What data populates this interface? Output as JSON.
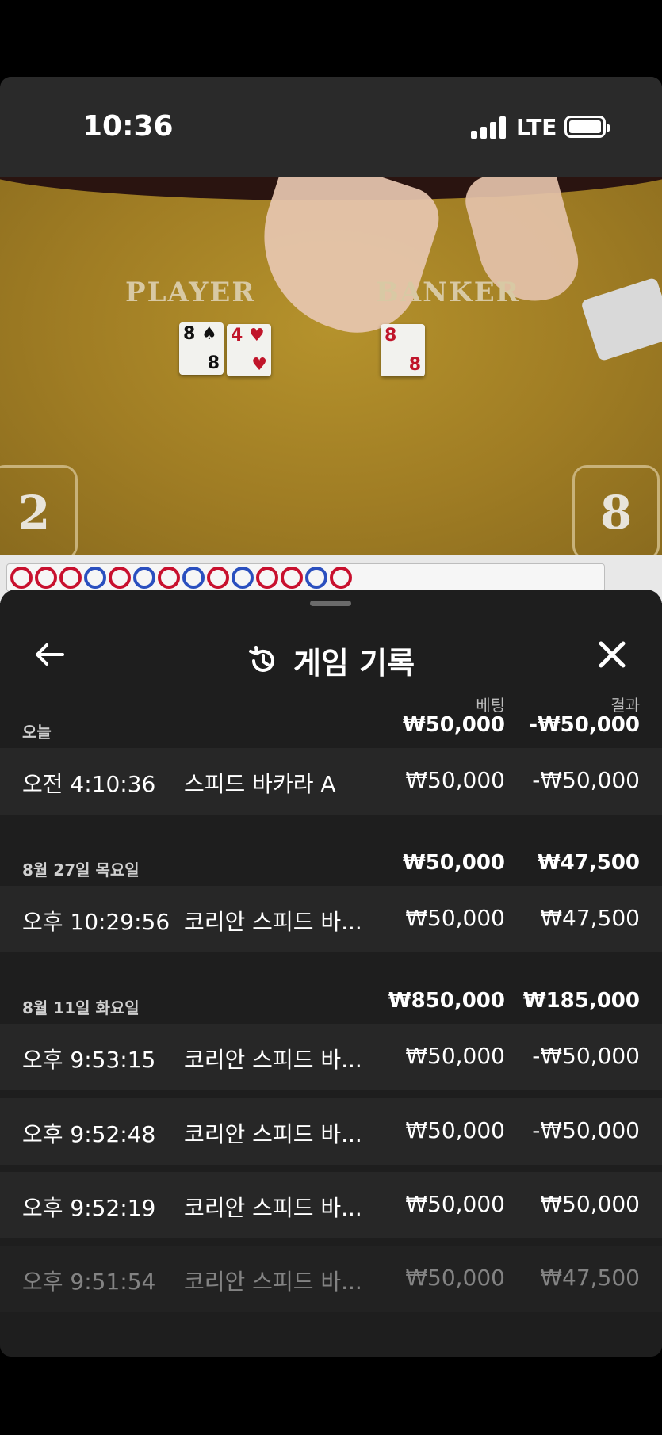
{
  "status_bar": {
    "time": "10:36",
    "network": "LTE"
  },
  "video": {
    "player_label": "PLAYER",
    "banker_label": "BANKER",
    "player_cards": [
      {
        "rank": "8",
        "suit": "♠"
      },
      {
        "rank": "4",
        "suit": "♥"
      }
    ],
    "banker_cards": [
      {
        "rank": "8",
        "suit": "♥"
      }
    ],
    "player_score": "2",
    "banker_score": "8"
  },
  "roadmap": {
    "results": [
      "P",
      "P",
      "P",
      "B",
      "P",
      "B",
      "P",
      "B",
      "P",
      "B",
      "P",
      "P",
      "B",
      "P"
    ]
  },
  "sheet": {
    "title": "게임 기록",
    "col_bet": "베팅",
    "col_result": "결과",
    "groups": [
      {
        "date": "오늘",
        "bet_total": "₩50,000",
        "result_total": "-₩50,000",
        "rows": [
          {
            "time": "오전 4:10:36",
            "game": "스피드 바카라 A",
            "bet": "₩50,000",
            "result": "-₩50,000"
          }
        ]
      },
      {
        "date": "8월 27일 목요일",
        "bet_total": "₩50,000",
        "result_total": "₩47,500",
        "rows": [
          {
            "time": "오후 10:29:56",
            "game": "코리안 스피드 바...",
            "bet": "₩50,000",
            "result": "₩47,500"
          }
        ]
      },
      {
        "date": "8월 11일 화요일",
        "bet_total": "₩850,000",
        "result_total": "₩185,000",
        "rows": [
          {
            "time": "오후 9:53:15",
            "game": "코리안 스피드 바...",
            "bet": "₩50,000",
            "result": "-₩50,000"
          },
          {
            "time": "오후 9:52:48",
            "game": "코리안 스피드 바...",
            "bet": "₩50,000",
            "result": "-₩50,000"
          },
          {
            "time": "오후 9:52:19",
            "game": "코리안 스피드 바...",
            "bet": "₩50,000",
            "result": "₩50,000"
          },
          {
            "time": "오후 9:51:54",
            "game": "코리안 스피드 바...",
            "bet": "₩50,000",
            "result": "₩47,500"
          }
        ]
      }
    ]
  },
  "icons": {
    "back": "arrow-left-icon",
    "history": "history-icon",
    "close": "close-icon"
  },
  "colors": {
    "player_red": "#c8102e",
    "banker_blue": "#2a4fbf",
    "sheet_bg": "#1e1e1e",
    "row_bg": "#272727"
  }
}
